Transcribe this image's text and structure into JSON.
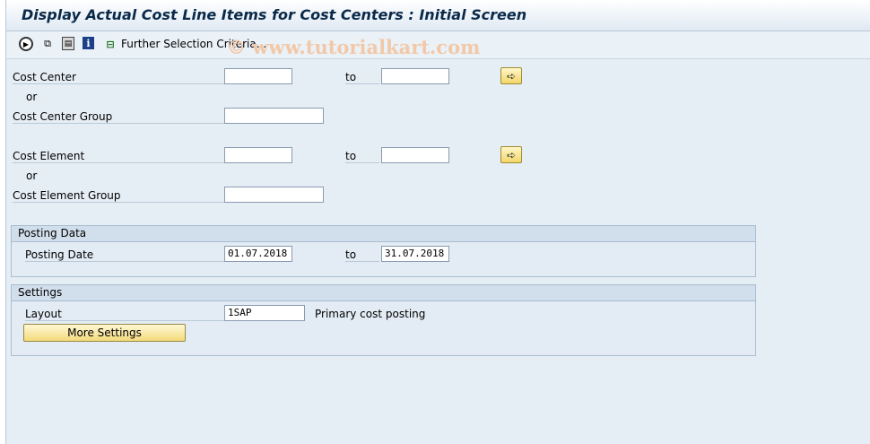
{
  "window": {
    "title": "Display Actual Cost Line Items for Cost Centers : Initial Screen"
  },
  "toolbar": {
    "icons": [
      "execute-icon",
      "copy-icon",
      "save-variant-icon",
      "info-icon",
      "hierarchy-icon"
    ],
    "further_selection_label": "Further Selection Criteria..."
  },
  "watermark": "© www.tutorialkart.com",
  "selection": {
    "cost_center_label": "Cost Center",
    "cost_center_from": "",
    "cost_center_to": "",
    "to_label": "to",
    "or_label": "or",
    "cost_center_group_label": "Cost Center Group",
    "cost_center_group_value": "",
    "cost_element_label": "Cost Element",
    "cost_element_from": "",
    "cost_element_to": "",
    "cost_element_group_label": "Cost Element Group",
    "cost_element_group_value": "",
    "arrow_icon": "multiple-selection-arrow-icon"
  },
  "posting_data": {
    "title": "Posting Data",
    "posting_date_label": "Posting Date",
    "date_from": "01.07.2018",
    "to_label": "to",
    "date_to": "31.07.2018"
  },
  "settings": {
    "title": "Settings",
    "layout_label": "Layout",
    "layout_value": "1SAP",
    "layout_description": "Primary cost posting",
    "more_settings_label": "More Settings"
  },
  "colors": {
    "background": "#e6eef5",
    "button": "#f3da7a",
    "title": "#0b2a4a"
  }
}
